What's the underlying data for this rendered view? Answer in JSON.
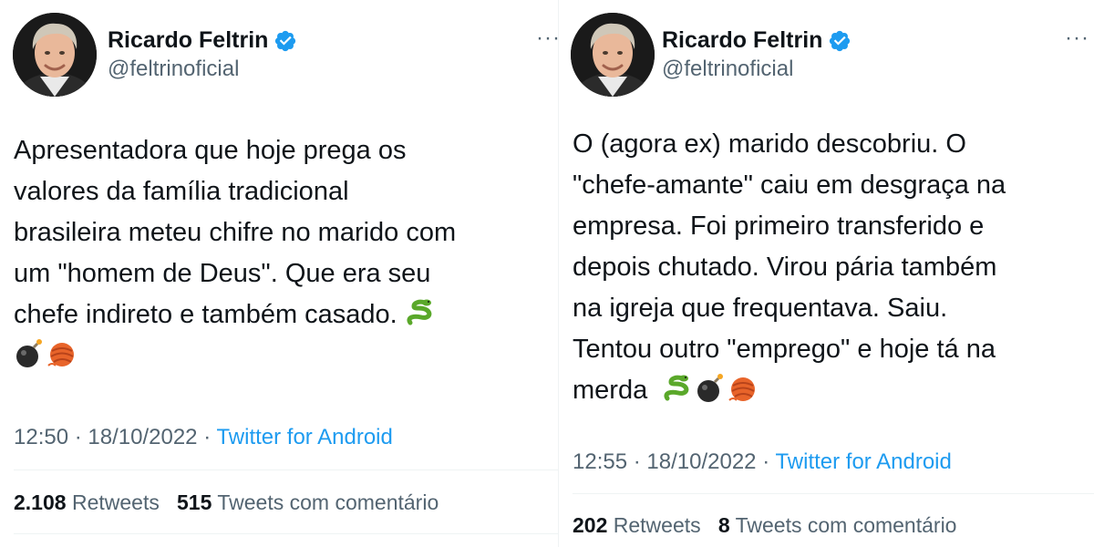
{
  "brand": {
    "verified_color": "#1d9bf0",
    "link_color": "#1d9bf0",
    "muted_color": "#536471"
  },
  "tweets": [
    {
      "author": {
        "name": "Ricardo Feltrin",
        "handle": "@feltrinoficial",
        "verified_icon": "verified-badge-icon"
      },
      "more_label": "···",
      "text_lines": [
        "Apresentadora que hoje prega os",
        "valores da família tradicional",
        "brasileira meteu chifre no marido com",
        "um \"homem de Deus\". Que era seu",
        "chefe indireto e também casado."
      ],
      "emojis": [
        "snake-emoji",
        "bomb-emoji",
        "yarn-emoji"
      ],
      "time": "12:50",
      "date": "18/10/2022",
      "separator": "·",
      "source": "Twitter for Android",
      "retweets_count": "2.108",
      "retweets_label": "Retweets",
      "quotes_count": "515",
      "quotes_label": "Tweets com comentário"
    },
    {
      "author": {
        "name": "Ricardo Feltrin",
        "handle": "@feltrinoficial",
        "verified_icon": "verified-badge-icon"
      },
      "more_label": "···",
      "text_lines": [
        "O (agora ex) marido descobriu. O",
        "\"chefe-amante\" caiu em desgraça na",
        "empresa. Foi primeiro transferido e",
        "depois chutado. Virou pária também",
        "na igreja que frequentava. Saiu.",
        "Tentou outro \"emprego\" e hoje tá na",
        "merda"
      ],
      "emojis": [
        "snake-emoji",
        "bomb-emoji",
        "yarn-emoji"
      ],
      "time": "12:55",
      "date": "18/10/2022",
      "separator": "·",
      "source": "Twitter for Android",
      "retweets_count": "202",
      "retweets_label": "Retweets",
      "quotes_count": "8",
      "quotes_label": "Tweets com comentário"
    }
  ]
}
